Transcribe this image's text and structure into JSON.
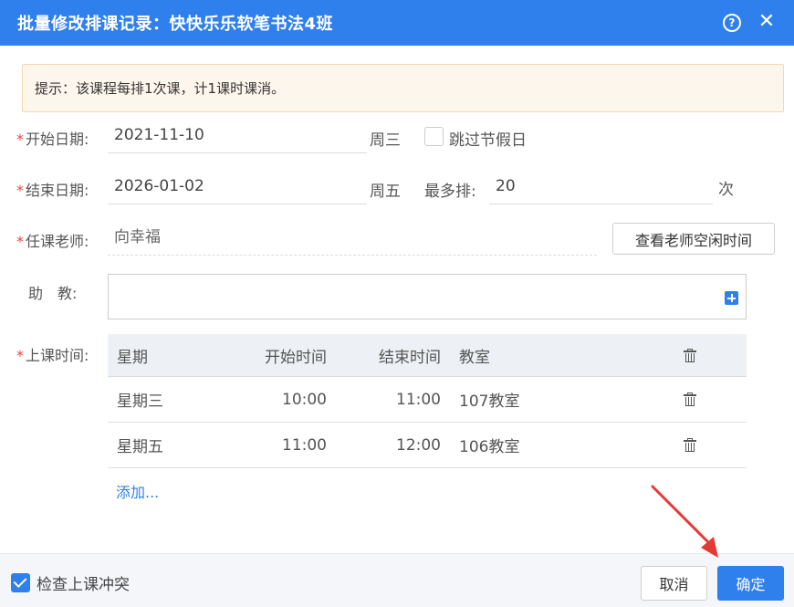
{
  "dialog": {
    "title": "批量修改排课记录：快快乐乐软笔书法4班",
    "help_glyph": "?",
    "close_glyph": "✕"
  },
  "tip": "提示：该课程每排1次课，计1课时课消。",
  "form": {
    "required_mark": "*",
    "start_date": {
      "label": "开始日期:",
      "value": "2021-11-10",
      "weekday": "周三"
    },
    "skip_holiday": {
      "label": "跳过节假日",
      "checked": false
    },
    "end_date": {
      "label": "结束日期:",
      "value": "2026-01-02",
      "weekday": "周五"
    },
    "max_sessions": {
      "label": "最多排:",
      "value": "20",
      "unit": "次"
    },
    "teacher": {
      "label": "任课老师:",
      "value": "向幸福",
      "button": "查看老师空闲时间"
    },
    "assistant": {
      "label": "助　教:",
      "value": ""
    },
    "schedule": {
      "label": "上课时间:",
      "headers": {
        "week": "星期",
        "start": "开始时间",
        "end": "结束时间",
        "room": "教室"
      },
      "rows": [
        {
          "week": "星期三",
          "start": "10:00",
          "end": "11:00",
          "room": "107教室"
        },
        {
          "week": "星期五",
          "start": "11:00",
          "end": "12:00",
          "room": "106教室"
        }
      ],
      "add_link": "添加..."
    }
  },
  "footer": {
    "check_conflict": {
      "label": "检查上课冲突",
      "checked": true
    },
    "cancel_label": "取消",
    "ok_label": "确定"
  },
  "colors": {
    "primary": "#2f80ed",
    "required": "#e64545",
    "tip_bg": "#fdf6ec",
    "arrow": "#e53935"
  }
}
